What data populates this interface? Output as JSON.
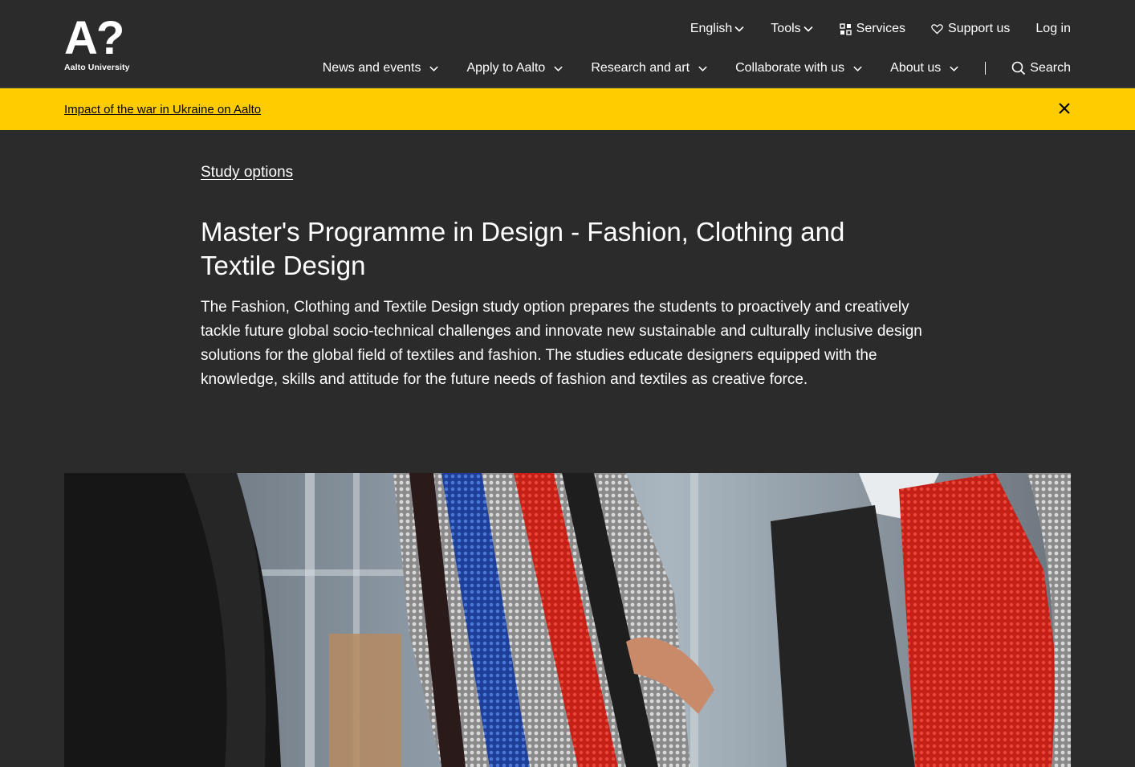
{
  "header": {
    "logo_mark": "A?",
    "logo_text": "Aalto University",
    "utility": {
      "language": "English",
      "tools": "Tools",
      "services": "Services",
      "support": "Support us",
      "login": "Log in"
    },
    "nav": [
      {
        "label": "News and events"
      },
      {
        "label": "Apply to Aalto"
      },
      {
        "label": "Research and art"
      },
      {
        "label": "Collaborate with us"
      },
      {
        "label": "About us"
      }
    ],
    "search_label": "Search"
  },
  "alert": {
    "link_text": "Impact of the war in Ukraine on Aalto"
  },
  "page": {
    "breadcrumb": "Study options",
    "title": "Master's Programme in Design - Fashion, Clothing and Textile Design",
    "lead": "The Fashion, Clothing and Textile Design study option prepares the students to proactively and creatively tackle future global socio-technical challenges and innovate new sustainable and culturally inclusive design solutions for the global field of textiles and fashion. The studies educate designers equipped with the knowledge, skills and attitude for the future needs of fashion and textiles as creative force."
  },
  "colors": {
    "background": "#2b2b2b",
    "alert": "#ffcc00",
    "text": "#ffffff"
  },
  "icons": {
    "language": "chevron-down-icon",
    "services": "grid-icon",
    "support": "heart-icon",
    "search": "search-icon",
    "close": "close-icon"
  }
}
